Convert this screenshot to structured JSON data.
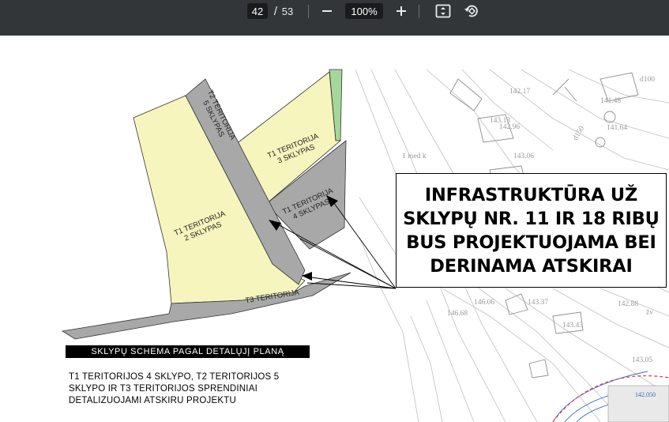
{
  "toolbar": {
    "current_page": "42",
    "separator": "/",
    "total_pages": "53",
    "zoom": "100%",
    "icons": [
      "minus-icon",
      "plus-icon",
      "fit-page-icon",
      "rotate-icon"
    ]
  },
  "colors": {
    "toolbar_bg": "#323639",
    "yellow_plot": "#f6f5bd",
    "gray_plot": "#a8a8a8",
    "green_strip": "#a5d79c"
  },
  "plan": {
    "labels": {
      "t2_line1": "T2 TERITORIJA",
      "t2_line2": "5 SKLYPAS",
      "t1_3_line1": "T1 TERITORIJA",
      "t1_3_line2": "3 SKLYPAS",
      "t1_4_line1": "T1 TERITORIJA",
      "t1_4_line2": "4 SKLYPAS",
      "t1_2_line1": "T1 TERITORIJA",
      "t1_2_line2": "2 SKLYPAS",
      "t3": "T3 TERITORIJA"
    },
    "survey": {
      "text1": "1 med k",
      "values": [
        "142.17",
        "143.13",
        "142.96",
        "141.48",
        "d100",
        "d150",
        "141.64",
        "143.06",
        "146.06",
        "143.37",
        "142.88",
        "146.68",
        "143.43",
        "143.05",
        "142.050",
        "žv"
      ]
    }
  },
  "callout": {
    "lines": [
      "INFRASTRUKTŪRA UŽ",
      "SKLYPŲ NR. 11 IR 18 RIBŲ",
      "BUS PROJEKTUOJAMA  BEI",
      "DERINAMA ATSKIRAI"
    ]
  },
  "caption": "SKLYPŲ SCHEMA PAGAL DETALŲJĮ PLANĄ",
  "note": {
    "lines": [
      "T1 TERITORIJOS 4 SKLYPO, T2 TERITORIJOS 5",
      "SKLYPO IR T3 TERITORIJOS SPRENDINIAI",
      "DETALIZUOJAMI ATSKIRU PROJEKTU"
    ]
  }
}
